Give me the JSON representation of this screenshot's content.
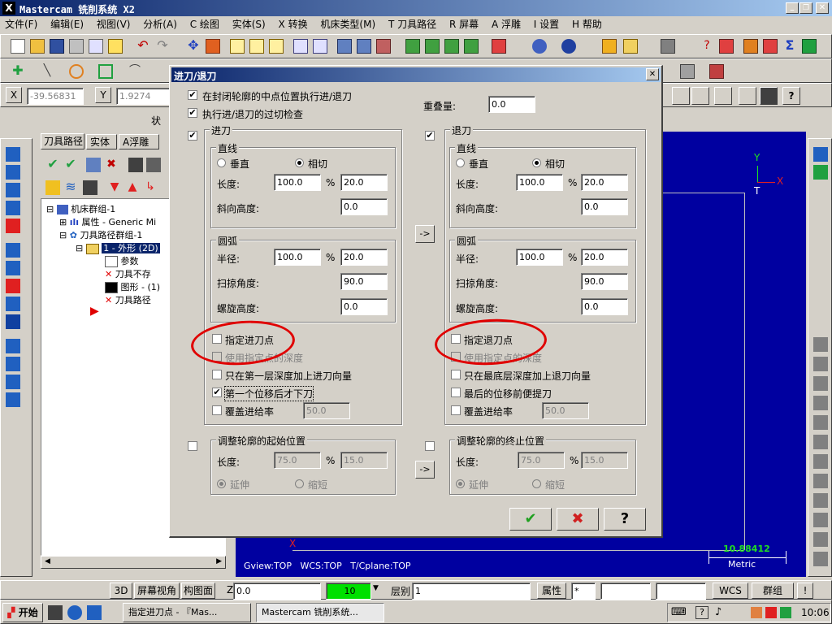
{
  "app": {
    "title": "Mastercam 铣削系统  X2"
  },
  "menu": [
    "文件(F)",
    "编辑(E)",
    "视图(V)",
    "分析(A)",
    "C 绘图",
    "实体(S)",
    "X 转换",
    "机床类型(M)",
    "T 刀具路径",
    "R 屏幕",
    "A 浮雕",
    "I 设置",
    "H 帮助"
  ],
  "coords": {
    "x_label": "X",
    "x_value": "-39.56831",
    "y_label": "Y",
    "y_value": "1.9274"
  },
  "left_panel": {
    "tabs": [
      "刀具路径",
      "实体",
      "A浮雕"
    ],
    "tree": [
      "机床群组-1",
      "属性 - Generic Mi",
      "刀具路径群组-1",
      "1 - 外形 (2D)",
      "参数",
      "刀具不存",
      "图形 - (1)",
      "刀具路径"
    ]
  },
  "partial_label": "状",
  "viewport": {
    "gview": "Gview:TOP   WCS:TOP   T/Cplane:TOP",
    "dimension": "10.88412",
    "units": "Metric",
    "axis_y": "Y",
    "axis_x": "X",
    "axis_t": "T",
    "axis_x2": "X"
  },
  "dialog": {
    "title": "进刀/退刀",
    "opt_midpoint": "在封闭轮廓的中点位置执行进/退刀",
    "opt_gouge": "执行进/退刀的过切检查",
    "overlap_label": "重叠量:",
    "overlap_value": "0.0",
    "entry": {
      "title": "进刀",
      "line_title": "直线",
      "perp": "垂直",
      "tangent": "相切",
      "length_label": "长度:",
      "length_pct": "100.0",
      "length_val": "20.0",
      "ramp_label": "斜向高度:",
      "ramp_val": "0.0",
      "arc_title": "圆弧",
      "radius_label": "半径:",
      "radius_pct": "100.0",
      "radius_val": "20.0",
      "sweep_label": "扫掠角度:",
      "sweep_val": "90.0",
      "helix_label": "螺旋高度:",
      "helix_val": "0.0",
      "specify_point": "指定进刀点",
      "use_depth": "使用指定点的深度",
      "first_depth": "只在第一层深度加上进刀向量",
      "after_first_move": "第一个位移后才下刀",
      "override_feed": "覆盖进给率",
      "feed_val": "50.0"
    },
    "exit": {
      "title": "退刀",
      "line_title": "直线",
      "perp": "垂直",
      "tangent": "相切",
      "length_label": "长度:",
      "length_pct": "100.0",
      "length_val": "20.0",
      "ramp_label": "斜向高度:",
      "ramp_val": "0.0",
      "arc_title": "圆弧",
      "radius_label": "半径:",
      "radius_pct": "100.0",
      "radius_val": "20.0",
      "sweep_label": "扫掠角度:",
      "sweep_val": "90.0",
      "helix_label": "螺旋高度:",
      "helix_val": "0.0",
      "specify_point": "指定退刀点",
      "use_depth": "使用指定点的深度",
      "last_depth": "只在最底层深度加上退刀向量",
      "before_last_move": "最后的位移前便提刀",
      "override_feed": "覆盖进给率",
      "feed_val": "50.0"
    },
    "copy_btn": "->",
    "adjust_start": {
      "title": "调整轮廓的起始位置",
      "length_label": "长度:",
      "pct": "75.0",
      "val": "15.0",
      "extend": "延伸",
      "shorten": "缩短"
    },
    "adjust_end": {
      "title": "调整轮廓的终止位置",
      "length_label": "长度:",
      "pct": "75.0",
      "val": "15.0",
      "extend": "延伸",
      "shorten": "缩短"
    },
    "pct_sign": "%",
    "ok": "✔",
    "cancel": "✖",
    "help": "?"
  },
  "statusbar": {
    "btn_3d": "3D",
    "screen_view": "屏幕视角",
    "plane": "构图面",
    "z_label": "Z",
    "z_value": "0.0",
    "color_value": "10",
    "level_label": "层别",
    "level_value": "1",
    "attr": "属性",
    "wcs": "WCS",
    "group": "群组"
  },
  "taskbar": {
    "start": "开始",
    "task1": "指定进刀点 - 『Mas...",
    "task2": "Mastercam 铣削系统...",
    "time": "10:06"
  }
}
